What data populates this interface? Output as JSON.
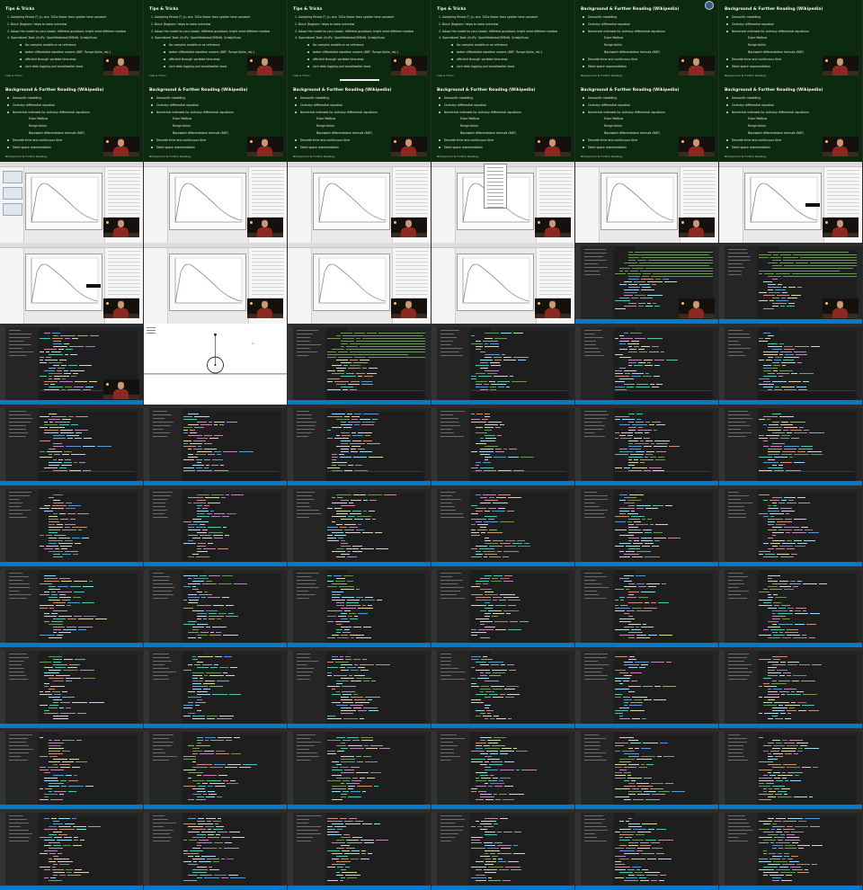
{
  "slide_a": {
    "title": "Tips & Tricks",
    "items": [
      "1.  Sampling Period (T_s): ans. 100x faster than system time constant",
      "2.  Block Diagram: helps to keep overview",
      "3.  Adapt the model to your needs: different questions might need different models",
      "4.  Specialized Tools (SciPy, OpenModelica/OMEdit, Scilab/Xcos)"
    ],
    "subitems": [
      "for complex models or as reference",
      "better differential equation solvers (BDF, Runge-Kutta, etc.)",
      "efficient through variable time-step",
      "nice data logging and visualization tools"
    ],
    "footer": "Tips & Tricks"
  },
  "slide_b": {
    "title": "Background & Further Reading (Wikipedia)",
    "items": [
      "Sensorific modelling",
      "Ordinary differential equation",
      "Numerical methods for ordinary differential equations"
    ],
    "subitems": [
      "Euler Method",
      "Runge-Kutta",
      "Backward differentiation formula (BDF)"
    ],
    "items2": [
      "Discrete time and continuous time",
      "State space representation"
    ],
    "footer": "Background & Further Reading"
  },
  "colors": {
    "slide_bg": "#0c2a0e",
    "editor_bg": "#1e1e1e",
    "status_bar": "#007acc",
    "plot_curve": "#8a7fb8"
  },
  "icons": {
    "record": "record-indicator-icon"
  }
}
